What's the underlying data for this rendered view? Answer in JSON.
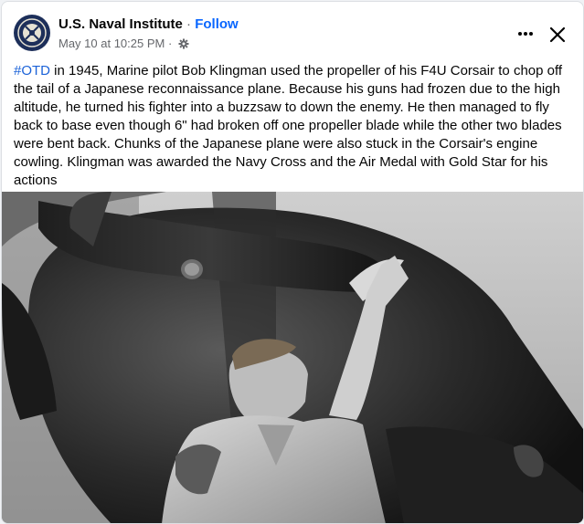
{
  "post": {
    "page_name": "U.S. Naval Institute",
    "separator": " · ",
    "follow_label": "Follow",
    "timestamp": "May 10 at 10:25 PM",
    "meta_separator": " · ",
    "audience_icon": "gear-icon",
    "more_icon": "more-options-icon",
    "close_icon": "close-icon",
    "hashtag": "#OTD",
    "text": " in 1945, Marine pilot Bob Klingman used the propeller of his F4U Corsair to chop off the tail of a Japanese reconnaissance plane. Because his guns had frozen due to the high altitude, he turned his fighter into a buzzsaw to down the enemy. He then managed to fly back to base even though 6\" had broken off one propeller blade while the other two blades were bent back. Chunks of the Japanese plane were also stuck in the Corsair's engine cowling. Klingman was awarded the Navy Cross and the Air Medal with Gold Star for his actions"
  },
  "colors": {
    "link_blue": "#0866ff",
    "hashtag_blue": "#1b62d8",
    "secondary_text": "#65676b",
    "avatar_navy": "#1d2f5a"
  }
}
